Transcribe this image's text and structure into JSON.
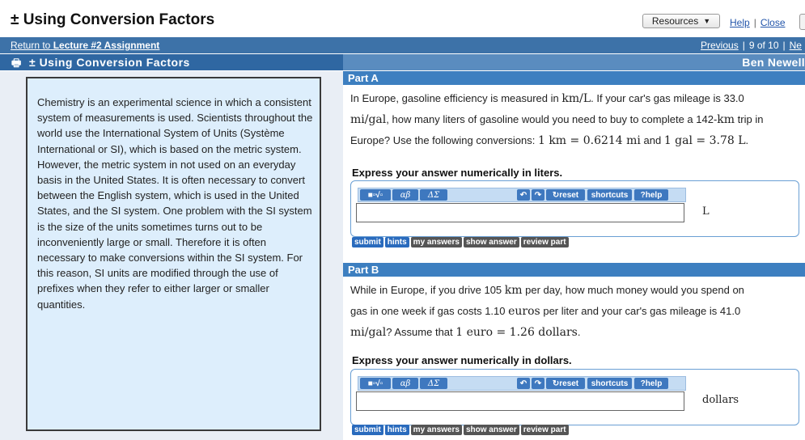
{
  "app": {
    "title": "± Using Conversion Factors",
    "resources_label": "Resources",
    "help_label": "Help",
    "close_label": "Close"
  },
  "nav": {
    "return_prefix": "Return to",
    "return_target": "Lecture #2 Assignment",
    "previous_label": "Previous",
    "position": "9 of 10",
    "next_label": "Ne"
  },
  "header": {
    "section_title": "± Using Conversion Factors",
    "user_name": "Ben Newell"
  },
  "intro": {
    "text": "Chemistry is an experimental science in which a consistent system of measurements is used. Scientists throughout the world use the International System of Units (Système International or SI), which is based on the metric system. However, the metric system in not used on an everyday basis in the United States. It is often necessary to convert between the English system, which is used in the United States, and the SI system. One problem with the SI system is the size of the units sometimes turns out to be inconveniently large or small. Therefore it is often necessary to make conversions within the SI system. For this reason, SI units are modified through the use of prefixes when they refer to either larger or smaller quantities."
  },
  "toolbar": {
    "template_btn": "■▫√▫",
    "greek_btn": "αβ",
    "delta_btn": "ΔΣ",
    "undo_icon": "undo-icon",
    "redo_icon": "redo-icon",
    "reset_label": "reset",
    "shortcuts_label": "shortcuts",
    "help_label": "help"
  },
  "actions": {
    "submit": "submit",
    "hints": "hints",
    "my_answers": "my answers",
    "show_answer": "show answer",
    "review_part": "review part"
  },
  "partA": {
    "label": "Part A",
    "q1": "In Europe, gasoline efficiency is measured in ",
    "m1": "km/L",
    "q2": ". If your car's gas mileage is 33.0",
    "m2": "mi/gal",
    "q3": ", how many liters of gasoline would you need to buy to complete a 142-",
    "m3": "km",
    "q4": " trip in",
    "q5": "Europe? Use the following conversions: ",
    "m4": "1 km = 0.6214 mi",
    "q6": " and ",
    "m5": "1 gal = 3.78 L",
    "q7": ".",
    "express": "Express your answer numerically in liters.",
    "answer_value": "",
    "unit": "L"
  },
  "partB": {
    "label": "Part B",
    "q1": "While in Europe, if you drive 105 ",
    "m1": "km",
    "q2": " per day, how much money would you spend on",
    "q3": "gas in one week if gas costs 1.10 ",
    "m2": "euros",
    "q4": " per liter and your car's gas mileage is 41.0",
    "m3": "mi/gal",
    "q5": "? Assume that ",
    "m4": "1 euro = 1.26 dollars",
    "q6": ".",
    "express": "Express your answer numerically in dollars.",
    "answer_value": "",
    "unit": "dollars"
  },
  "colors": {
    "nav_blue": "#3d72a8",
    "part_header": "#3d7fc0",
    "intro_bg": "#ddeefc",
    "submit_blue": "#2a6bbd"
  }
}
